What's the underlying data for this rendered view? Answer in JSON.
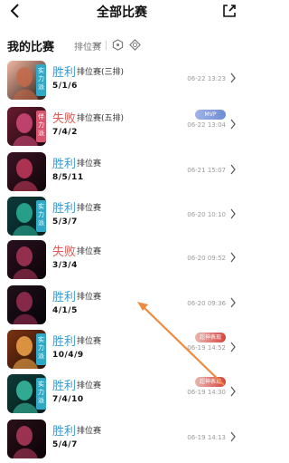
{
  "header": {
    "title": "全部比赛",
    "back_icon": "chevron-left-icon",
    "share_icon": "share-icon"
  },
  "filter": {
    "title": "我的比赛",
    "mode": "排位赛",
    "icons": [
      "hexagon-dot-icon",
      "hexagon-target-icon"
    ]
  },
  "colors": {
    "win": "#3a9bd0",
    "loss": "#e25b56",
    "annotation_arrow": "#f08a3e"
  },
  "matches": [
    {
      "result": "胜利",
      "result_type": "win",
      "match_type": "排位赛(三排)",
      "kda": "5/1/6",
      "time": "06-22 13:23",
      "avatar_tag": "实力派",
      "badge": ""
    },
    {
      "result": "失败",
      "result_type": "loss",
      "match_type": "排位赛(五排)",
      "kda": "7/4/2",
      "time": "06-22 13:04",
      "avatar_tag": "伴力派",
      "badge": "MVP"
    },
    {
      "result": "胜利",
      "result_type": "win",
      "match_type": "排位赛",
      "kda": "8/5/11",
      "time": "06-21 15:07",
      "avatar_tag": "",
      "badge": ""
    },
    {
      "result": "胜利",
      "result_type": "win",
      "match_type": "排位赛",
      "kda": "5/3/7",
      "time": "06-20 10:10",
      "avatar_tag": "实力派",
      "badge": ""
    },
    {
      "result": "失败",
      "result_type": "loss",
      "match_type": "排位赛",
      "kda": "3/3/4",
      "time": "06-20 09:52",
      "avatar_tag": "",
      "badge": ""
    },
    {
      "result": "胜利",
      "result_type": "win",
      "match_type": "排位赛",
      "kda": "4/1/5",
      "time": "06-20 09:36",
      "avatar_tag": "",
      "badge": ""
    },
    {
      "result": "胜利",
      "result_type": "win",
      "match_type": "排位赛",
      "kda": "10/4/9",
      "time": "06-19 14:52",
      "avatar_tag": "实力派",
      "badge": "超神表现"
    },
    {
      "result": "胜利",
      "result_type": "win",
      "match_type": "排位赛",
      "kda": "7/4/10",
      "time": "06-19 14:30",
      "avatar_tag": "实力派",
      "badge": "超神表现"
    },
    {
      "result": "胜利",
      "result_type": "win",
      "match_type": "排位赛",
      "kda": "5/4/7",
      "time": "06-19 14:13",
      "avatar_tag": "",
      "badge": ""
    }
  ]
}
